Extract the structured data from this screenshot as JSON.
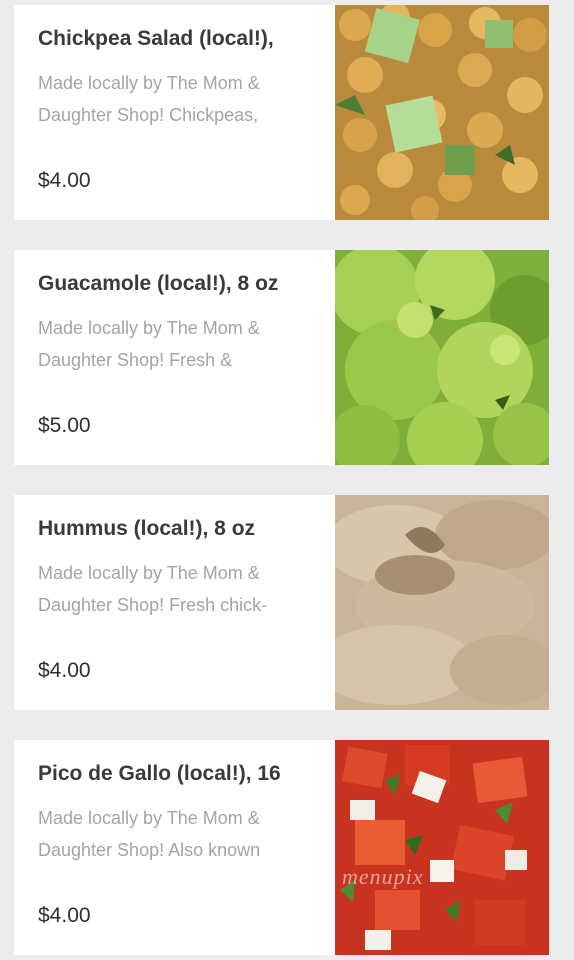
{
  "menu_items": [
    {
      "title": "Chickpea Salad (local!),",
      "description": "Made locally by The Mom & Daughter Shop! Chickpeas,",
      "price": "$4.00",
      "photo": "chickpea-salad-photo"
    },
    {
      "title": "Guacamole (local!), 8 oz",
      "description": "Made locally by The Mom & Daughter Shop! Fresh &",
      "price": "$5.00",
      "photo": "guacamole-photo"
    },
    {
      "title": "Hummus (local!), 8 oz",
      "description": "Made locally by The Mom & Daughter Shop! Fresh chick-",
      "price": "$4.00",
      "photo": "hummus-photo"
    },
    {
      "title": "Pico de Gallo (local!), 16",
      "description": "Made locally by The Mom & Daughter Shop! Also known",
      "price": "$4.00",
      "photo": "pico-de-gallo-photo"
    }
  ],
  "watermark": "menupix",
  "colors": {
    "background": "#ececef",
    "card": "#ffffff",
    "title": "#3a3a3a",
    "description": "#a4a4a4",
    "price": "#2f2f2f"
  }
}
